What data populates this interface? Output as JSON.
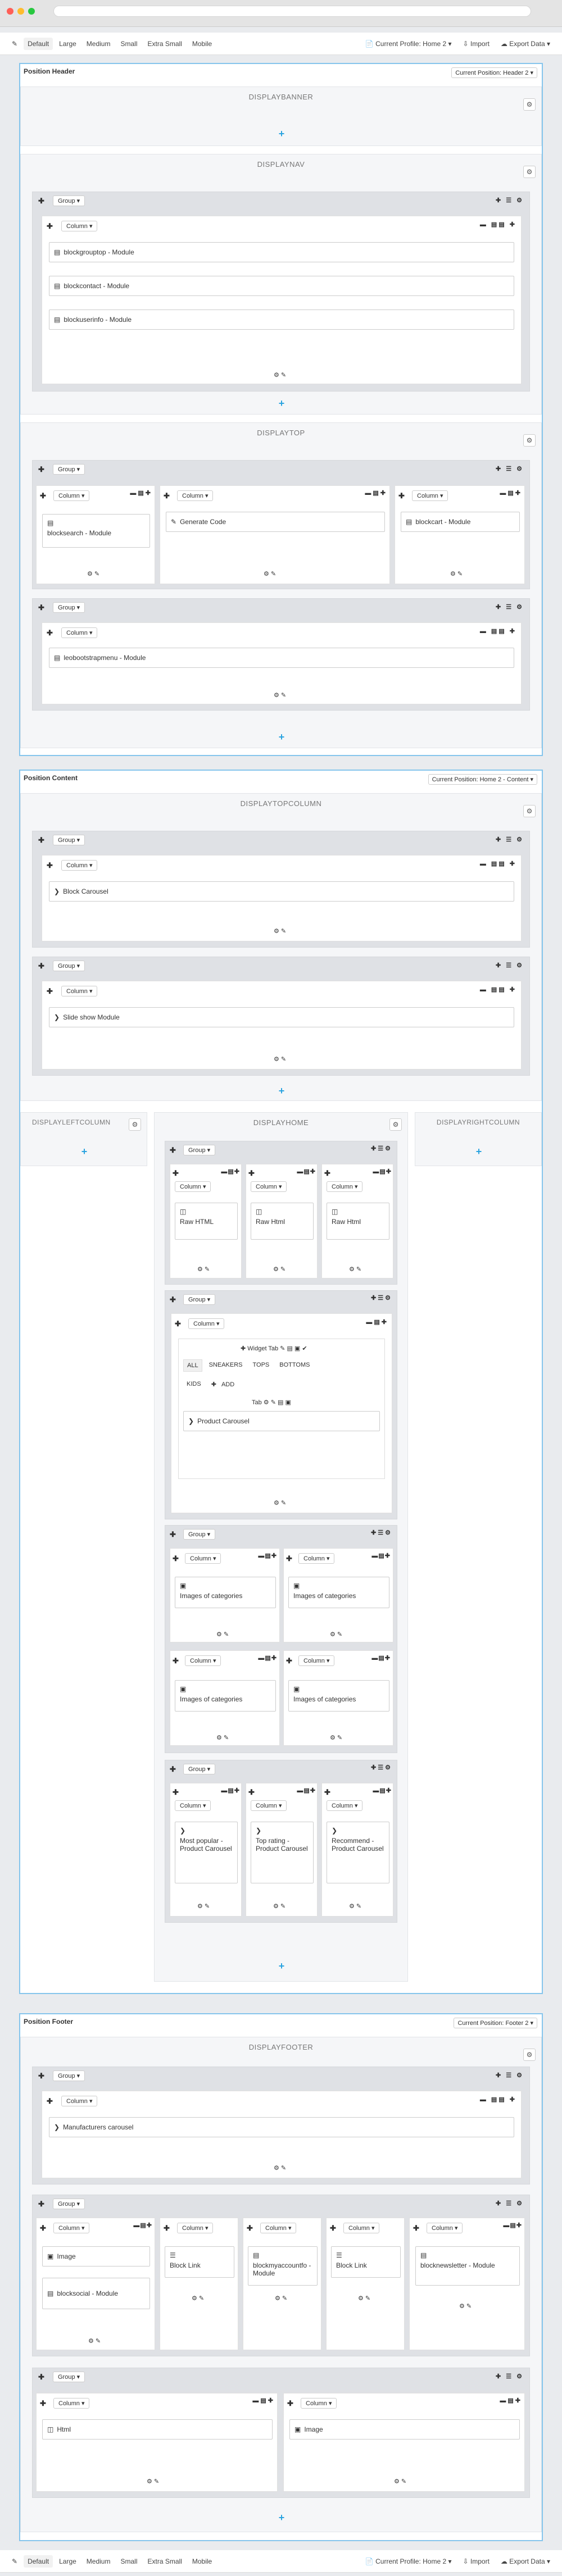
{
  "toolbar": {
    "devices": [
      "Default",
      "Large",
      "Medium",
      "Small",
      "Extra Small",
      "Mobile"
    ],
    "profile": "Current Profile: Home 2",
    "import": "Import",
    "export": "Export Data"
  },
  "header": {
    "title": "Position Header",
    "select": "Current Position: Header 2"
  },
  "content": {
    "title": "Position Content",
    "select": "Current Position: Home 2 - Content"
  },
  "footer": {
    "title": "Position Footer",
    "select": "Current Position: Footer 2"
  },
  "hooks": {
    "banner": "DISPLAYBANNER",
    "nav": "DISPLAYNAV",
    "top": "DISPLAYTOP",
    "topcol": "DISPLAYTOPCOLUMN",
    "left": "DISPLAYLEFTCOLUMN",
    "home": "DISPLAYHOME",
    "right": "DISPLAYRIGHTCOLUMN",
    "foot": "DISPLAYFOOTER"
  },
  "labels": {
    "group": "Group",
    "column": "Column",
    "widget_tab": "Widget Tab",
    "tab": "Tab",
    "add": "ADD"
  },
  "modules": {
    "nav1": "blockgrouptop - Module",
    "nav2": "blockcontact - Module",
    "nav3": "blockuserinfo - Module",
    "search": "blocksearch - Module",
    "gencode": "Generate Code",
    "cart": "blockcart - Module",
    "menu": "leobootstrapmenu - Module",
    "carousel": "Block Carousel",
    "slideshow": "Slide show Module",
    "rawhtml": "Raw HTML",
    "rawhtml2": "Raw Html",
    "product_carousel": "Product Carousel",
    "images_cat": "Images of categories",
    "mostpop": "Most popular - Product Carousel",
    "toprating": "Top rating - Product Carousel",
    "recommend": "Recommend - Product Carousel",
    "manufacturers": "Manufacturers carousel",
    "image": "Image",
    "blocksocial": "blocksocial - Module",
    "blocklink": "Block Link",
    "myaccount": "blockmyaccountfo - Module",
    "newsletter": "blocknewsletter - Module",
    "html": "Html",
    "image2": "Image"
  },
  "tabs": [
    "ALL",
    "SNEAKERS",
    "TOPS",
    "BOTTOMS",
    "KIDS"
  ]
}
